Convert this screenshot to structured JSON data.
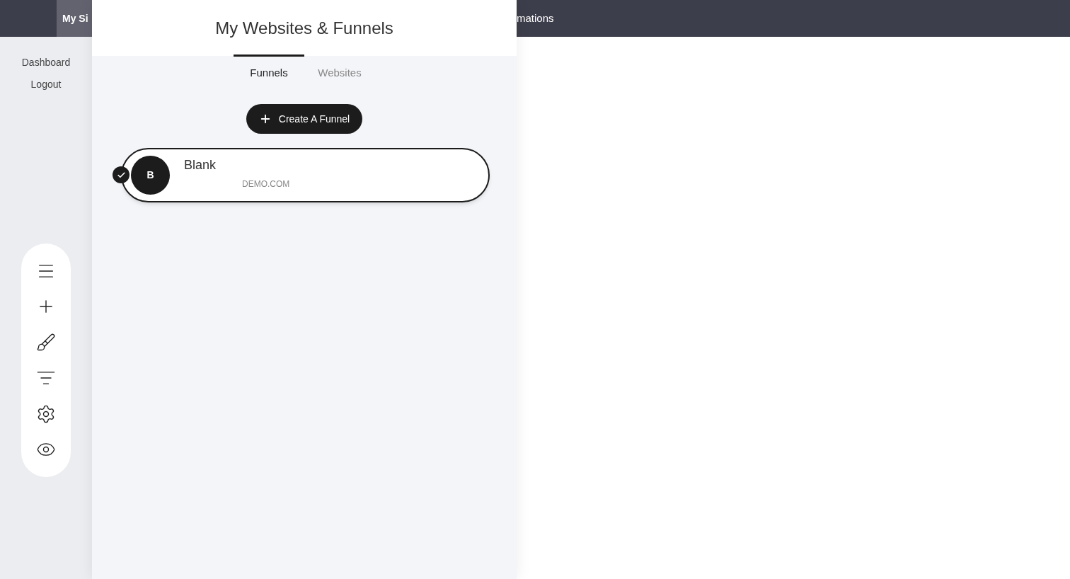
{
  "top_bar": {
    "active_tab": "My Si",
    "menu_item": "mations"
  },
  "sidebar": {
    "links": [
      "Dashboard",
      "Logout"
    ]
  },
  "panel": {
    "title": "My Websites & Funnels",
    "tabs": [
      {
        "label": "Funnels",
        "selected": true
      },
      {
        "label": "Websites",
        "selected": false
      }
    ],
    "create_button": "Create A Funnel",
    "funnels": [
      {
        "initial": "B",
        "name": "Blank",
        "domain": "DEMO.COM",
        "selected": true
      }
    ]
  }
}
